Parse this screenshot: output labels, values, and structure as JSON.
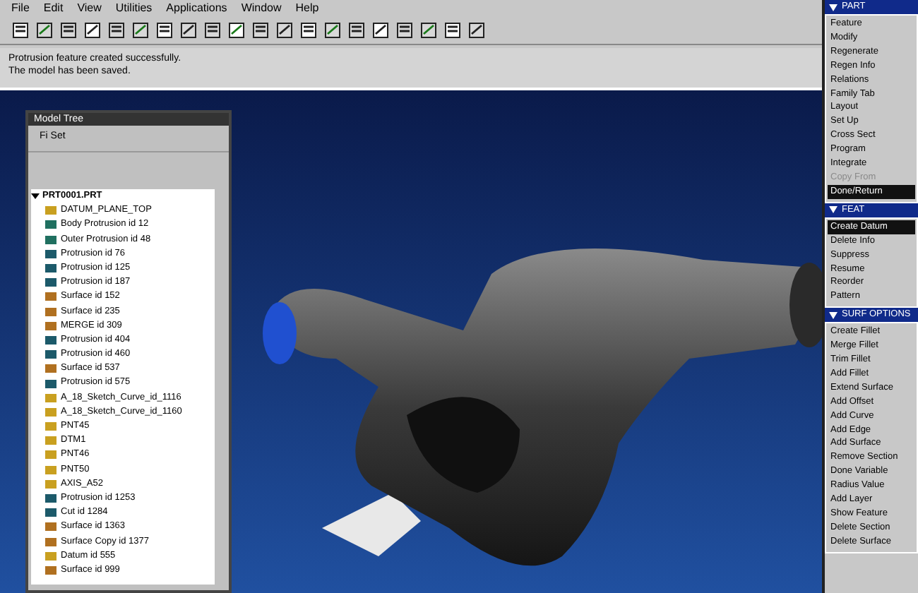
{
  "menu_bar": [
    "File",
    "Edit",
    "View",
    "Utilities",
    "Applications",
    "Window",
    "Help"
  ],
  "message_area": {
    "lines": [
      "Protrusion feature created successfully.",
      "The model has been saved."
    ]
  },
  "model_tree": {
    "title": "Model Tree",
    "toolbar_label": "Fi Set",
    "root": {
      "label": "PRT0001.PRT",
      "expanded": true,
      "children": [
        {
          "label": "DATUM_PLANE_TOP",
          "kind": "datum"
        },
        {
          "label": "Body Protrusion id 12",
          "kind": "solid"
        },
        {
          "label": "Outer Protrusion id 48",
          "kind": "solid"
        },
        {
          "label": "Protrusion id 76",
          "kind": "feature"
        },
        {
          "label": "Protrusion id 125",
          "kind": "feature"
        },
        {
          "label": "Protrusion id 187",
          "kind": "feature"
        },
        {
          "label": "Surface id 152",
          "kind": "surface"
        },
        {
          "label": "Surface id 235",
          "kind": "surface"
        },
        {
          "label": "MERGE id 309",
          "kind": "surface"
        },
        {
          "label": "Protrusion id 404",
          "kind": "feature"
        },
        {
          "label": "Protrusion id 460",
          "kind": "feature"
        },
        {
          "label": "Surface id 537",
          "kind": "surface"
        },
        {
          "label": "Protrusion id 575",
          "kind": "feature"
        },
        {
          "label": "A_18_Sketch_Curve_id_1116",
          "kind": "datum"
        },
        {
          "label": "A_18_Sketch_Curve_id_1160",
          "kind": "datum"
        },
        {
          "label": "PNT45",
          "kind": "datum"
        },
        {
          "label": "DTM1",
          "kind": "datum"
        },
        {
          "label": "PNT46",
          "kind": "datum"
        },
        {
          "label": "PNT50",
          "kind": "datum"
        },
        {
          "label": "AXIS_A52",
          "kind": "datum"
        },
        {
          "label": "Protrusion id 1253",
          "kind": "feature"
        },
        {
          "label": "Cut id 1284",
          "kind": "feature"
        },
        {
          "label": "Surface id 1363",
          "kind": "surface"
        },
        {
          "label": "Surface Copy id 1377",
          "kind": "surface"
        },
        {
          "label": "Datum id 555",
          "kind": "datum"
        },
        {
          "label": "Surface id 999",
          "kind": "surface"
        }
      ]
    }
  },
  "menus": [
    {
      "title": "PART",
      "items": [
        {
          "label": "Feature",
          "selected": false,
          "disabled": false
        },
        {
          "label": "Modify",
          "selected": false,
          "disabled": false
        },
        {
          "label": "Regenerate",
          "selected": false,
          "disabled": false
        },
        {
          "label": "Regen Info",
          "selected": false,
          "disabled": false
        },
        {
          "label": "Relations",
          "selected": false,
          "disabled": false
        },
        {
          "label": "Family Tab",
          "selected": false,
          "disabled": false
        },
        {
          "label": "Layout",
          "selected": false,
          "disabled": false
        },
        {
          "label": "Set Up",
          "selected": false,
          "disabled": false
        },
        {
          "label": "Cross Sect",
          "selected": false,
          "disabled": false
        },
        {
          "label": "Program",
          "selected": false,
          "disabled": false
        },
        {
          "label": "Integrate",
          "selected": false,
          "disabled": false
        },
        {
          "label": "Copy From",
          "selected": false,
          "disabled": true
        },
        {
          "label": "Done/Return",
          "selected": true,
          "disabled": false
        }
      ]
    },
    {
      "title": "FEAT",
      "items": [
        {
          "label": "Create Datum",
          "selected": true,
          "disabled": false
        },
        {
          "label": "Delete Info",
          "selected": false,
          "disabled": false
        },
        {
          "label": "Suppress",
          "selected": false,
          "disabled": false
        },
        {
          "label": "Resume",
          "selected": false,
          "disabled": false
        },
        {
          "label": "Reorder",
          "selected": false,
          "disabled": false
        },
        {
          "label": "Pattern",
          "selected": false,
          "disabled": false
        }
      ]
    },
    {
      "title": "SURF OPTIONS",
      "items": [
        {
          "label": "Create Fillet",
          "selected": false,
          "disabled": false
        },
        {
          "label": "Merge Fillet",
          "selected": false,
          "disabled": false
        },
        {
          "label": "Trim Fillet",
          "selected": false,
          "disabled": false
        },
        {
          "label": "Add Fillet",
          "selected": false,
          "disabled": false
        },
        {
          "label": "Extend Surface",
          "selected": false,
          "disabled": false
        },
        {
          "label": "Add Offset",
          "selected": false,
          "disabled": false
        },
        {
          "label": "Add Curve",
          "selected": false,
          "disabled": false
        },
        {
          "label": "Add Edge",
          "selected": false,
          "disabled": false
        },
        {
          "label": "Add Surface",
          "selected": false,
          "disabled": false
        },
        {
          "label": "Remove Section",
          "selected": false,
          "disabled": false
        },
        {
          "label": "Done Variable",
          "selected": false,
          "disabled": false
        },
        {
          "label": "Radius Value",
          "selected": false,
          "disabled": false
        },
        {
          "label": "Add Layer",
          "selected": false,
          "disabled": false
        },
        {
          "label": "Show Feature",
          "selected": false,
          "disabled": false
        },
        {
          "label": "Delete Section",
          "selected": false,
          "disabled": false
        },
        {
          "label": "Delete Surface",
          "selected": false,
          "disabled": false
        }
      ]
    }
  ]
}
